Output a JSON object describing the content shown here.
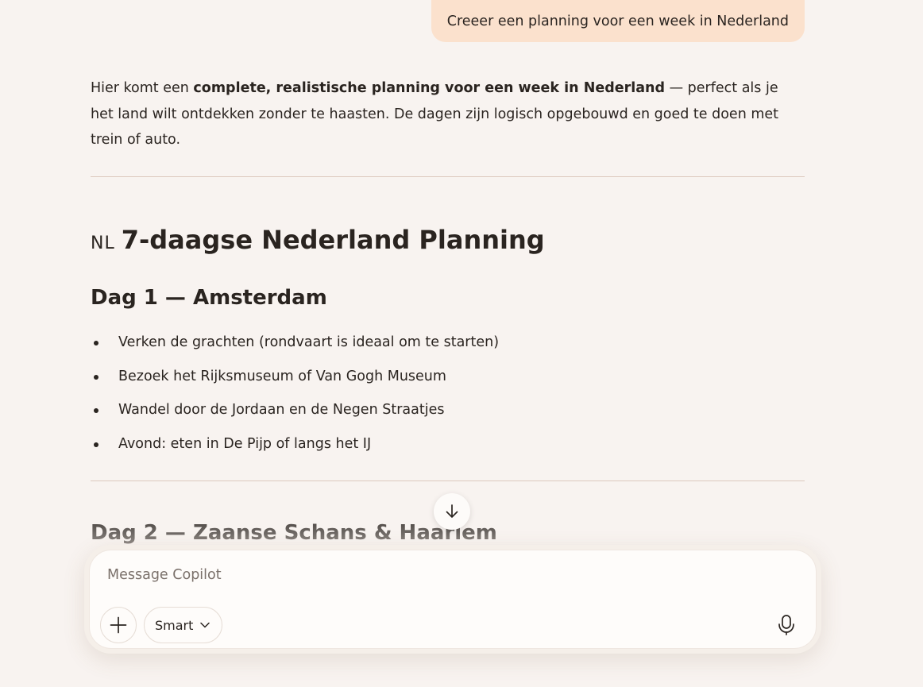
{
  "conversation": {
    "user_message": "Creeer een planning voor een week in Nederland",
    "intro": {
      "prefix": "Hier komt een ",
      "bold": "complete, realistische planning voor een week in Nederland",
      "suffix": " — perfect als je het land wilt ontdekken zonder te haasten. De dagen zijn logisch opgebouwd en goed te doen met trein of auto."
    },
    "title_flag": "NL",
    "title": "7-daagse Nederland Planning",
    "days": [
      {
        "heading": "Dag 1 — Amsterdam",
        "items": [
          "Verken de grachten (rondvaart is ideaal om te starten)",
          "Bezoek het Rijksmuseum of Van Gogh Museum",
          "Wandel door de Jordaan en de Negen Straatjes",
          "Avond: eten in De Pijp of langs het IJ"
        ]
      },
      {
        "heading": "Dag 2 — Zaanse Schans & Haarlem",
        "items": []
      }
    ]
  },
  "scroll_down": {
    "icon": "arrow-down-icon"
  },
  "composer": {
    "placeholder": "Message Copilot",
    "value": "",
    "add_icon": "plus-icon",
    "mode_label": "Smart",
    "mode_icon": "chevron-down-icon",
    "mic_icon": "microphone-icon"
  }
}
